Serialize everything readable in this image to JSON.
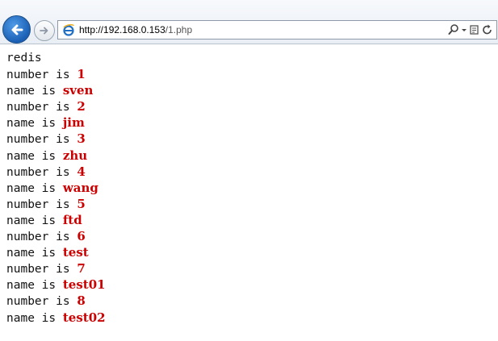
{
  "browser": {
    "url_host": "http://192.168.0.153",
    "url_path": "/1.php",
    "icons": [
      "back-icon",
      "forward-icon",
      "ie-page-icon",
      "search-icon",
      "dropdown-icon",
      "compatibility-icon",
      "refresh-icon"
    ]
  },
  "page": {
    "heading": "redis",
    "lines": [
      {
        "label": "number is ",
        "value": "1"
      },
      {
        "label": "name is ",
        "value": "sven"
      },
      {
        "label": "number is ",
        "value": "2"
      },
      {
        "label": "name is ",
        "value": "jim"
      },
      {
        "label": "number is ",
        "value": "3"
      },
      {
        "label": "name is ",
        "value": "zhu"
      },
      {
        "label": "number is ",
        "value": "4"
      },
      {
        "label": "name is ",
        "value": "wang"
      },
      {
        "label": "number is ",
        "value": "5"
      },
      {
        "label": "name is ",
        "value": "ftd"
      },
      {
        "label": "number is ",
        "value": "6"
      },
      {
        "label": "name is ",
        "value": "test"
      },
      {
        "label": "number is ",
        "value": "7"
      },
      {
        "label": "name is ",
        "value": "test01"
      },
      {
        "label": "number is ",
        "value": "8"
      },
      {
        "label": "name is ",
        "value": "test02"
      }
    ]
  },
  "colors": {
    "value_text": "#cc0000",
    "back_button": "#1a5fb4"
  }
}
